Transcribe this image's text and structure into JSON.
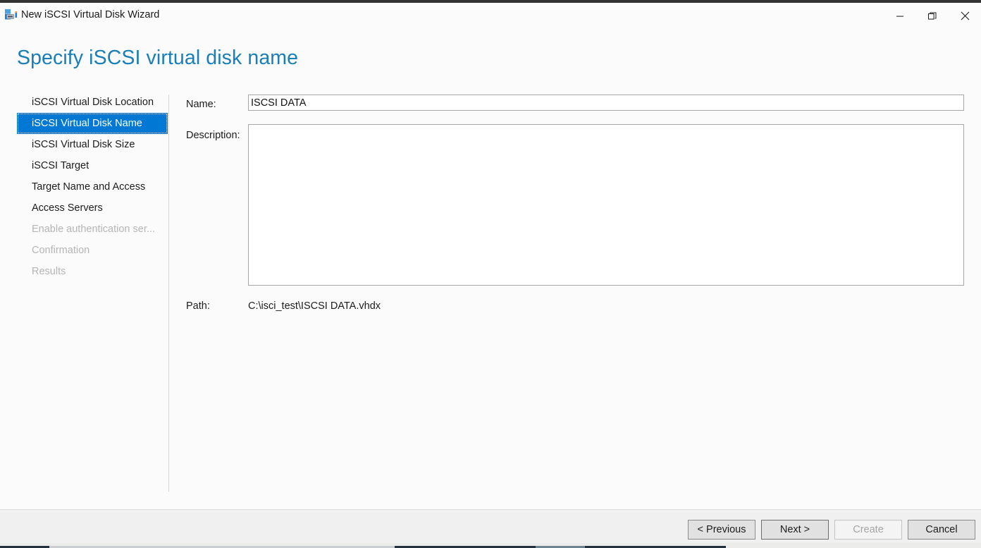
{
  "titlebar": {
    "icon": "iscsi-disk-icon",
    "title": "New iSCSI Virtual Disk Wizard",
    "minimize_label": "—",
    "restore_label": "restore-icon",
    "close_label": "✕"
  },
  "page": {
    "heading": "Specify iSCSI virtual disk name"
  },
  "sidebar": {
    "items": [
      {
        "label": "iSCSI Virtual Disk Location",
        "state": "enabled"
      },
      {
        "label": "iSCSI Virtual Disk Name",
        "state": "selected"
      },
      {
        "label": "iSCSI Virtual Disk Size",
        "state": "enabled"
      },
      {
        "label": "iSCSI Target",
        "state": "enabled"
      },
      {
        "label": "Target Name and Access",
        "state": "enabled"
      },
      {
        "label": "Access Servers",
        "state": "enabled"
      },
      {
        "label": "Enable authentication ser...",
        "state": "disabled"
      },
      {
        "label": "Confirmation",
        "state": "disabled"
      },
      {
        "label": "Results",
        "state": "disabled"
      }
    ]
  },
  "form": {
    "name_label": "Name:",
    "name_value": "ISCSI DATA",
    "name_placeholder": "",
    "description_label": "Description:",
    "description_value": "",
    "description_placeholder": "",
    "path_label": "Path:",
    "path_value": "C:\\isci_test\\ISCSI DATA.vhdx"
  },
  "footer": {
    "previous_label": "< Previous",
    "next_label": "Next >",
    "create_label": "Create",
    "cancel_label": "Cancel"
  },
  "colors": {
    "accent": "#0078d4",
    "heading": "#1a7eb8",
    "titlebar_top": "#333333",
    "footer_bg": "#f0f0f0",
    "page_bg": "#fbfbfb",
    "disabled_text": "#b5b5b5"
  }
}
